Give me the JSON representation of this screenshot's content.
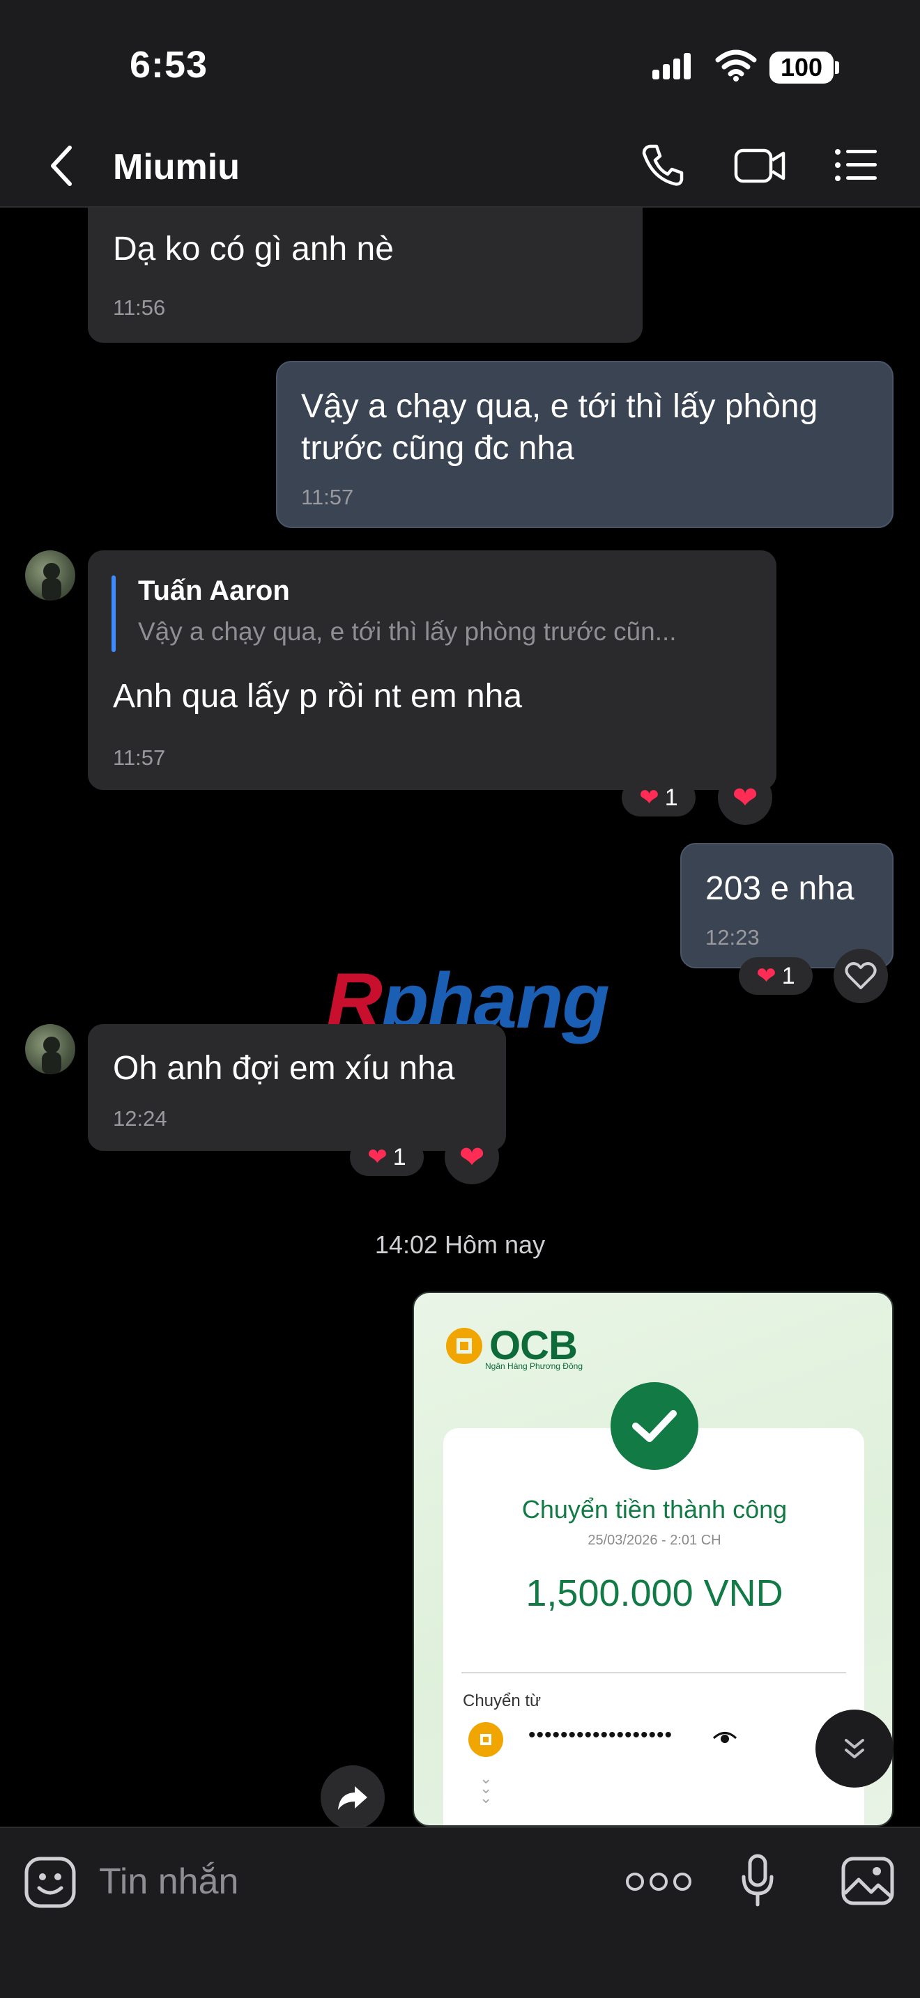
{
  "status_bar": {
    "time": "6:53",
    "battery": "100"
  },
  "header": {
    "contact_name": "Miumiu"
  },
  "messages": [
    {
      "text": "Dạ ko có gì anh nè",
      "time": "11:56"
    },
    {
      "text": "Vậy a chạy qua, e tới thì lấy phòng trước cũng đc nha",
      "time": "11:57"
    },
    {
      "quote_author": "Tuấn Aaron",
      "quote_text": "Vậy a chạy qua, e tới thì lấy phòng trước cũn...",
      "text": "Anh qua lấy p rồi nt em nha",
      "time": "11:57",
      "reaction_count": "1"
    },
    {
      "text": "203 e nha",
      "time": "12:23",
      "reaction_count": "1"
    },
    {
      "text": "Oh anh đợi em xíu nha",
      "time": "12:24",
      "reaction_count": "1"
    }
  ],
  "date_separator": "14:02 Hôm nay",
  "watermark": {
    "part1": "R",
    "part2": "phang"
  },
  "receipt": {
    "bank": "OCB",
    "bank_sub": "Ngân Hàng Phương Đông",
    "status": "Chuyển tiền thành công",
    "datetime": "25/03/2026 - 2:01 CH",
    "amount": "1,500.000 VND",
    "from_label": "Chuyển từ",
    "from_account": "••••••••••••••••••"
  },
  "composer": {
    "placeholder": "Tin nhắn"
  },
  "colors": {
    "accent_blue": "#3d8bfd",
    "heart_red": "#ff2d55",
    "ocb_green": "#127a45"
  }
}
